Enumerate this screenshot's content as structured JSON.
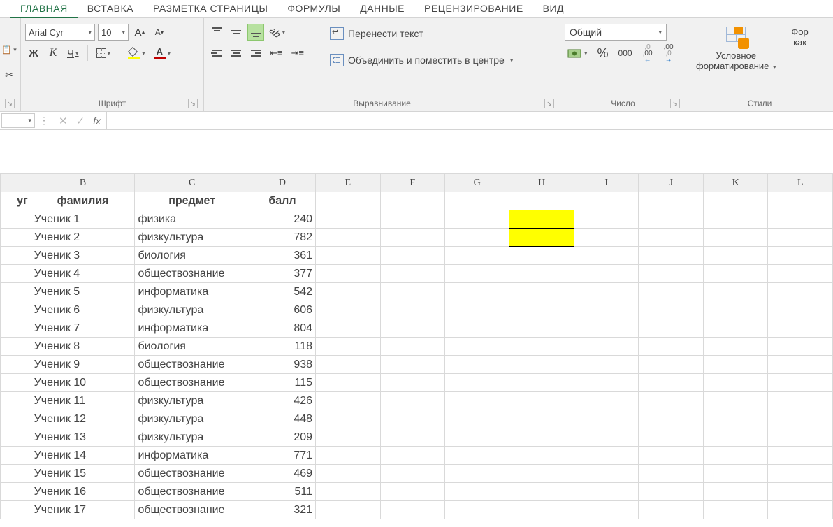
{
  "ribbon_tabs": [
    "ГЛАВНАЯ",
    "ВСТАВКА",
    "РАЗМЕТКА СТРАНИЦЫ",
    "ФОРМУЛЫ",
    "ДАННЫЕ",
    "РЕЦЕНЗИРОВАНИЕ",
    "ВИД"
  ],
  "active_tab": 0,
  "font": {
    "name": "Arial Cyr",
    "size": "10",
    "increase_label": "А",
    "decrease_label": "А",
    "bold": "Ж",
    "italic": "К",
    "underline": "Ч",
    "group_label": "Шрифт"
  },
  "alignment": {
    "wrap_text": "Перенести текст",
    "merge_center": "Объединить и поместить в центре",
    "group_label": "Выравнивание"
  },
  "number": {
    "format": "Общий",
    "percent": "%",
    "thousands": "000",
    "inc_dec": ",00",
    "dec_dec": ",00",
    "group_label": "Число"
  },
  "styles": {
    "cond_fmt_line1": "Условное",
    "cond_fmt_line2": "форматирование",
    "fmt_as_line1": "Фор",
    "fmt_as_line2": "как",
    "group_label": "Стили"
  },
  "formula_bar": {
    "name_box": "",
    "value": "",
    "fx": "fx"
  },
  "columns": [
    "B",
    "C",
    "D",
    "E",
    "F",
    "G",
    "H",
    "I",
    "J",
    "K",
    "L"
  ],
  "first_col_header_fragment": "уг",
  "headers": {
    "b": "фамилия",
    "c": "предмет",
    "d": "балл"
  },
  "rows": [
    {
      "b": "Ученик 1",
      "c": "физика",
      "d": 240
    },
    {
      "b": "Ученик 2",
      "c": "физкультура",
      "d": 782
    },
    {
      "b": "Ученик 3",
      "c": "биология",
      "d": 361
    },
    {
      "b": "Ученик 4",
      "c": "обществознание",
      "d": 377
    },
    {
      "b": "Ученик 5",
      "c": "информатика",
      "d": 542
    },
    {
      "b": "Ученик 6",
      "c": "физкультура",
      "d": 606
    },
    {
      "b": "Ученик 7",
      "c": "информатика",
      "d": 804
    },
    {
      "b": "Ученик 8",
      "c": "биология",
      "d": 118
    },
    {
      "b": "Ученик 9",
      "c": "обществознание",
      "d": 938
    },
    {
      "b": "Ученик 10",
      "c": "обществознание",
      "d": 115
    },
    {
      "b": "Ученик 11",
      "c": "физкультура",
      "d": 426
    },
    {
      "b": "Ученик 12",
      "c": "физкультура",
      "d": 448
    },
    {
      "b": "Ученик 13",
      "c": "физкультура",
      "d": 209
    },
    {
      "b": "Ученик 14",
      "c": "информатика",
      "d": 771
    },
    {
      "b": "Ученик 15",
      "c": "обществознание",
      "d": 469
    },
    {
      "b": "Ученик 16",
      "c": "обществознание",
      "d": 511
    },
    {
      "b": "Ученик 17",
      "c": "обществознание",
      "d": 321
    }
  ],
  "highlighted_cells": [
    "H2",
    "H3"
  ]
}
